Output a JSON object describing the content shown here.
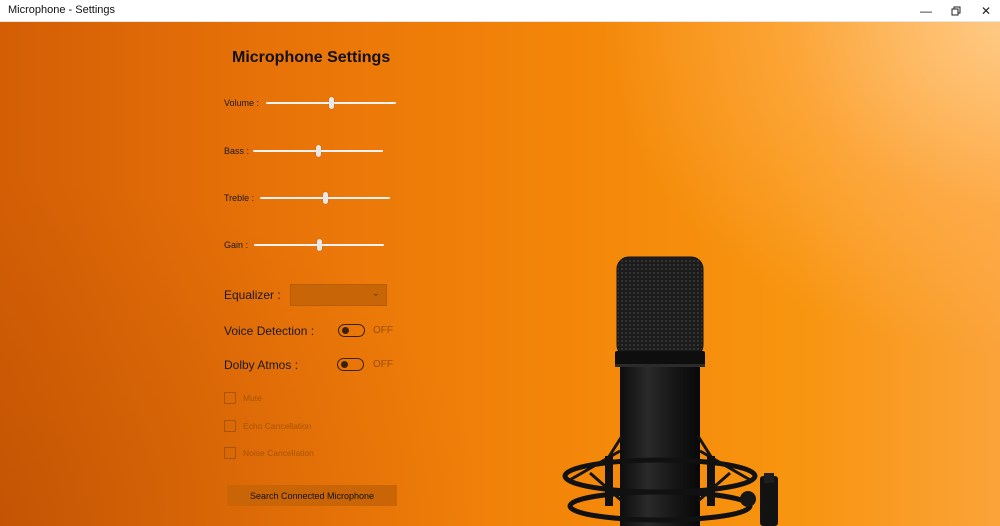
{
  "window": {
    "title": "Microphone - Settings",
    "minimize_icon": "minimize-icon",
    "restore_icon": "restore-icon",
    "close_icon": "close-icon"
  },
  "settings": {
    "heading": "Microphone Settings",
    "sliders": [
      {
        "label": "Volume :",
        "value": 0.5
      },
      {
        "label": "Bass :",
        "value": 0.5
      },
      {
        "label": "Treble :",
        "value": 0.5
      },
      {
        "label": "Gain :",
        "value": 0.5
      }
    ],
    "equalizer": {
      "label": "Equalizer :",
      "value": "",
      "icon": "chevron-down-icon"
    },
    "voice_detection": {
      "label": "Voice Detection :",
      "state": "OFF"
    },
    "dolby_atmos": {
      "label": "Dolby Atmos :",
      "state": "OFF"
    },
    "checkboxes": [
      {
        "label": "Mute",
        "checked": false
      },
      {
        "label": "Echo Cancellation",
        "checked": false
      },
      {
        "label": "Noise Cancellation",
        "checked": false
      }
    ],
    "search_button": "Search Connected Microphone"
  },
  "colors": {
    "background_accent": "#f28a1c",
    "control_fill": "#c96507"
  }
}
